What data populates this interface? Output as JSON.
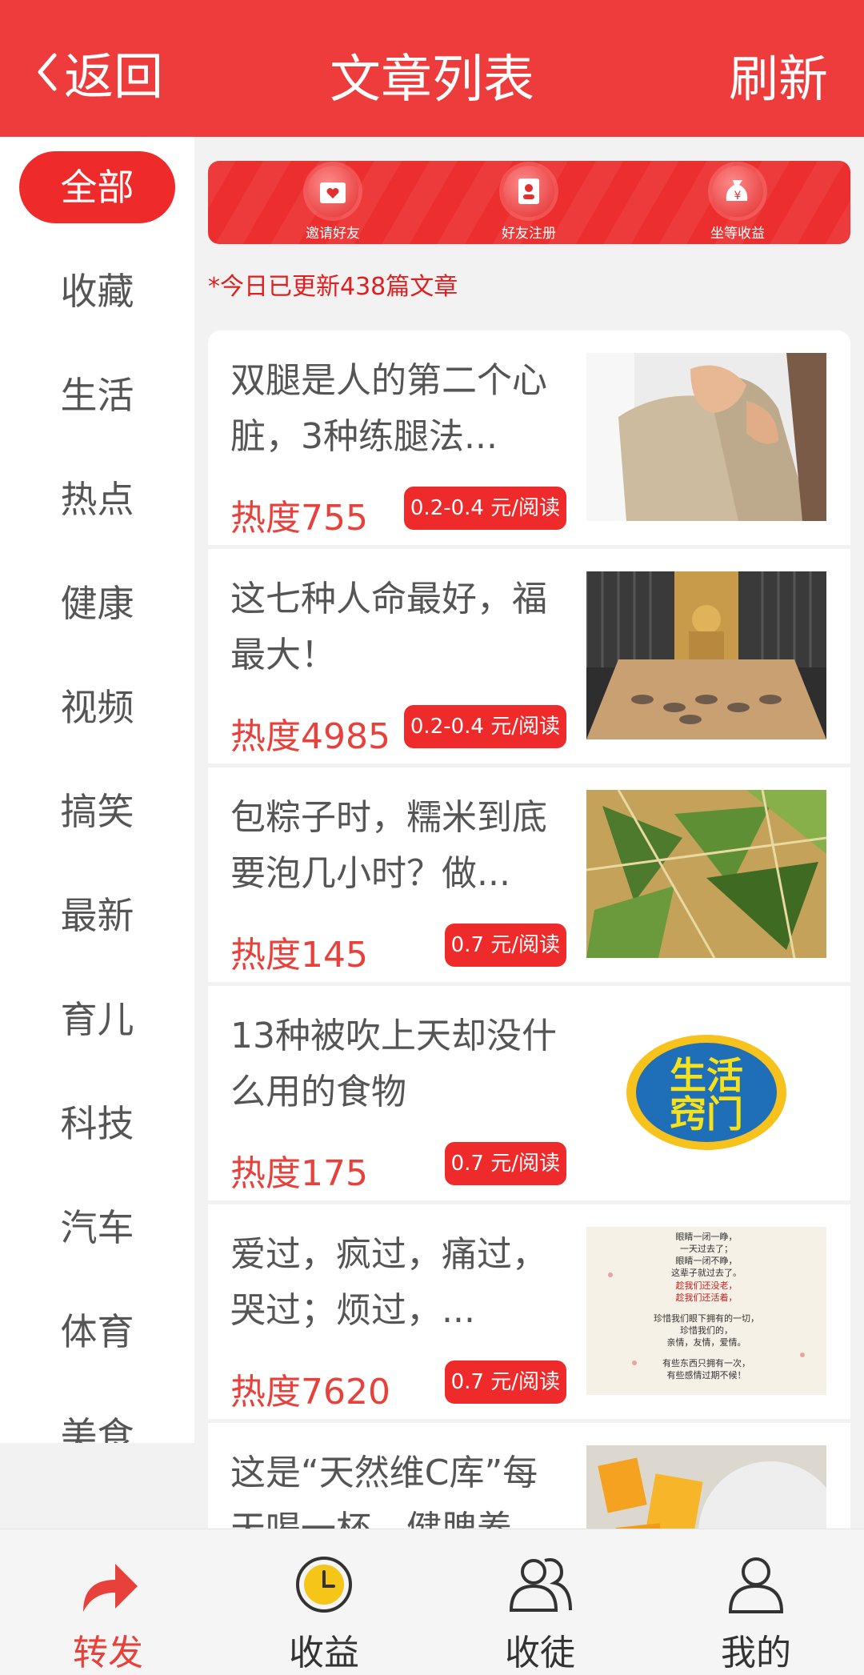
{
  "header": {
    "back_label": "返回",
    "title": "文章列表",
    "refresh_label": "刷新"
  },
  "sidebar": {
    "items": [
      "全部",
      "收藏",
      "生活",
      "热点",
      "健康",
      "视频",
      "搞笑",
      "最新",
      "育儿",
      "科技",
      "汽车",
      "体育",
      "美食"
    ],
    "active_index": 0
  },
  "banner": {
    "items": [
      "邀请好友",
      "好友注册",
      "坐等收益"
    ]
  },
  "update_note": "*今日已更新438篇文章",
  "articles": [
    {
      "title": "双腿是人的第二个心脏，3种练腿法...",
      "heat": "热度755",
      "price": "0.2-0.4 元/阅读",
      "thumb": "legs-photo"
    },
    {
      "title": "这七种人命最好，福最大！",
      "heat": "热度4985",
      "price": "0.2-0.4 元/阅读",
      "thumb": "buddha-hall-photo"
    },
    {
      "title": "包粽子时，糯米到底要泡几小时？做...",
      "heat": "热度145",
      "price": "0.7 元/阅读",
      "thumb": "zongzi-photo"
    },
    {
      "title": "13种被吹上天却没什么用的食物",
      "heat": "热度175",
      "price": "0.7 元/阅读",
      "thumb": "logo-生活窍门"
    },
    {
      "title": "爱过，疯过，痛过，哭过；烦过，...",
      "heat": "热度7620",
      "price": "0.7 元/阅读",
      "thumb": "poem-card"
    },
    {
      "title": "这是“天然维C库”每天喝一杯，健脾养...",
      "heat": "",
      "price": "",
      "thumb": "mango-photo"
    }
  ],
  "thumb_texts": {
    "logo_line1": "生活",
    "logo_line2": "窍门",
    "poem_lines": [
      "眼睛一闭一睁，",
      "一天过去了；",
      "眼睛一闭不睁，",
      "这辈子就过去了。",
      "趁我们还没老，",
      "趁我们还活着，",
      "珍惜我们眼下拥有的一切，",
      "珍惜我们的，",
      "亲情，友情，爱情。",
      "有些东西只拥有一次，",
      "有些感情过期不候！"
    ]
  },
  "tabbar": {
    "items": [
      {
        "label": "转发",
        "icon": "share-arrow-icon"
      },
      {
        "label": "收益",
        "icon": "clock-coin-icon"
      },
      {
        "label": "收徒",
        "icon": "two-users-icon"
      },
      {
        "label": "我的",
        "icon": "user-icon"
      }
    ],
    "active_index": 0
  },
  "colors": {
    "brand_red": "#ee3b3b",
    "heat_red": "#e8403a",
    "text_gray": "#555555"
  }
}
